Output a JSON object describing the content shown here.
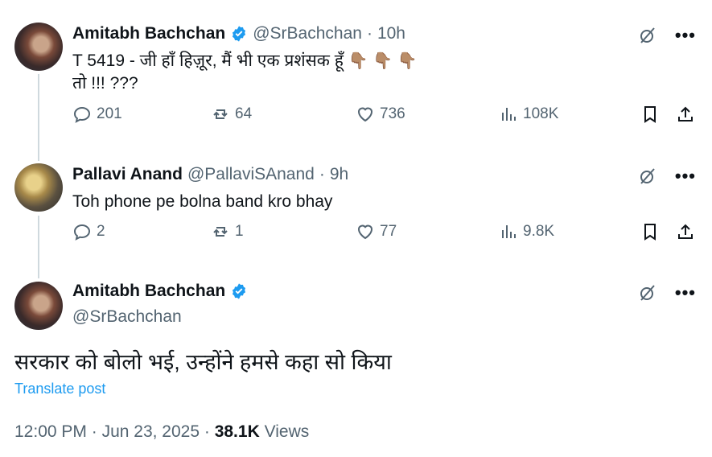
{
  "tweets": [
    {
      "name": "Amitabh Bachchan",
      "handle": "@SrBachchan",
      "sep": "·",
      "time": "10h",
      "text_line1": "T 5419 - जी हाँ हिज़ूर, मैं भी एक प्रशंसक हूँ",
      "emoji": "👇🏽 👇🏽 👇🏽",
      "text_line2": "तो !!! ???",
      "replies": "201",
      "reposts": "64",
      "likes": "736",
      "views": "108K"
    },
    {
      "name": "Pallavi Anand",
      "handle": "@PallaviSAnand",
      "sep": "·",
      "time": "9h",
      "text": "Toh phone pe bolna band kro bhay",
      "replies": "2",
      "reposts": "1",
      "likes": "77",
      "views": "9.8K"
    }
  ],
  "main_tweet": {
    "name": "Amitabh Bachchan",
    "handle": "@SrBachchan",
    "text": "सरकार को बोलो भई, उन्होंने हमसे कहा सो किया",
    "translate_label": "Translate post",
    "time": "12:00 PM",
    "sep1": "·",
    "date": "Jun 23, 2025",
    "sep2": "·",
    "views_count": "38.1K",
    "views_label": "Views"
  },
  "more_label": "•••",
  "colors": {
    "accent": "#1d9bf0",
    "text": "#0f1419",
    "secondary": "#536471",
    "line": "#cfd9de"
  }
}
